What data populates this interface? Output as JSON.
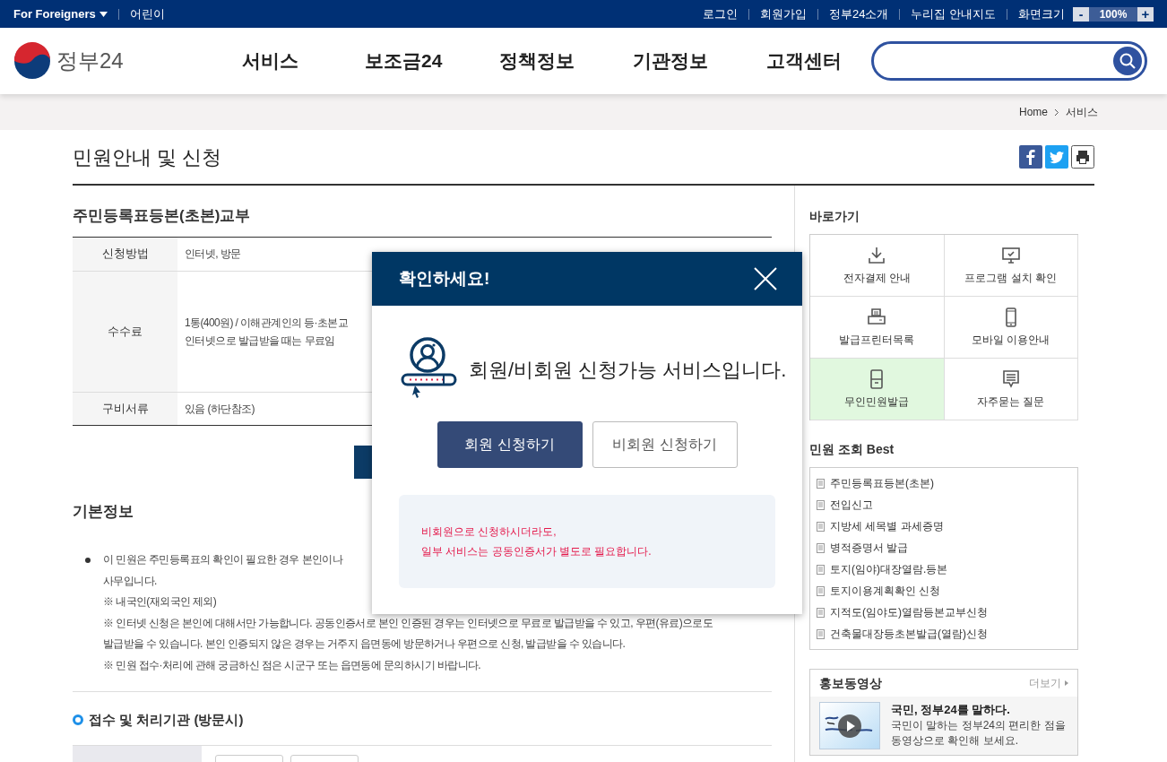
{
  "top_bar": {
    "left_links": [
      {
        "label": "For Foreigners",
        "kind": "dropdown"
      },
      {
        "label": "어린이",
        "kind": "link"
      }
    ],
    "right_links": [
      "로그인",
      "회원가입",
      "정부24소개",
      "누리집 안내지도"
    ],
    "zoom": {
      "label": "화면크기",
      "minus": "-",
      "value": "100%",
      "plus": "+"
    }
  },
  "header": {
    "logo_text": "정부24",
    "nav": [
      "서비스",
      "보조금24",
      "정책정보",
      "기관정보",
      "고객센터"
    ]
  },
  "breadcrumb": [
    "Home",
    "서비스"
  ],
  "page_title": "민원안내 및 신청",
  "service": {
    "title": "주민등록표등본(초본)교부",
    "rows": [
      {
        "label": "신청방법",
        "lines": [
          "인터넷, 방문"
        ]
      },
      {
        "label": "수수료",
        "lines": [
          "1통(400원) / 이해관계인의 등·초본교",
          "인터넷으로 발급받을 때는 무료임"
        ]
      },
      {
        "label": "구비서류",
        "lines": [
          "있음 (하단참조)"
        ]
      }
    ]
  },
  "basic_info": {
    "title": "기본정보",
    "lines": [
      "이 민원은 주민등록표의 확인이 필요한 경우 본인이나",
      "사무입니다.",
      "※ 내국인(재외국인 제외)",
      "※ 인터넷 신청은 본인에 대해서만 가능합니다. 공동인증서로 본인 인증된 경우는 인터넷으로 무료로 발급받을 수 있고, 우편(유료)으로도",
      "발급받을 수 있습니다. 본인 인증되지 않은 경우는 거주지 읍면동에 방문하거나 우편으로 신청, 발급받을 수 있습니다.",
      "※ 민원 접수·처리에 관해 궁금하신 점은 시군구 또는 읍면동에 문의하시기 바랍니다."
    ]
  },
  "agency_section": {
    "title": "접수 및 처리기관 (방문시)"
  },
  "sidebar": {
    "shortcuts_title": "바로가기",
    "shortcuts": [
      {
        "label": "전자결제 안내",
        "highlighted": false
      },
      {
        "label": "프로그램 설치 확인",
        "highlighted": false
      },
      {
        "label": "발급프린터목록",
        "highlighted": false
      },
      {
        "label": "모바일 이용안내",
        "highlighted": false
      },
      {
        "label": "무인민원발급",
        "highlighted": true
      },
      {
        "label": "자주묻는 질문",
        "highlighted": false
      }
    ],
    "best_title": "민원 조회 Best",
    "best": [
      "주민등록표등본(초본)",
      "전입신고",
      "지방세 세목별 과세증명",
      "병적증명서 발급",
      "토지(임야)대장열람.등본",
      "토지이용계획확인 신청",
      "지적도(임야도)열람등본교부신청",
      "건축물대장등초본발급(열람)신청"
    ],
    "video": {
      "title": "홍보동영상",
      "more": "더보기",
      "headline": "국민, 정부24를 말하다.",
      "description": [
        "국민이 말하는 정부24의 편리한 점을",
        "동영상으로 확인해 보세요."
      ]
    }
  },
  "modal": {
    "title": "확인하세요!",
    "message": "회원/비회원 신청가능 서비스입니다.",
    "buttons": [
      {
        "label": "회원 신청하기",
        "kind": "primary"
      },
      {
        "label": "비회원 신청하기",
        "kind": "secondary"
      }
    ],
    "notice": [
      "비회원으로 신청하시더라도,",
      "일부 서비스는 공동인증서가 별도로 필요합니다."
    ]
  }
}
